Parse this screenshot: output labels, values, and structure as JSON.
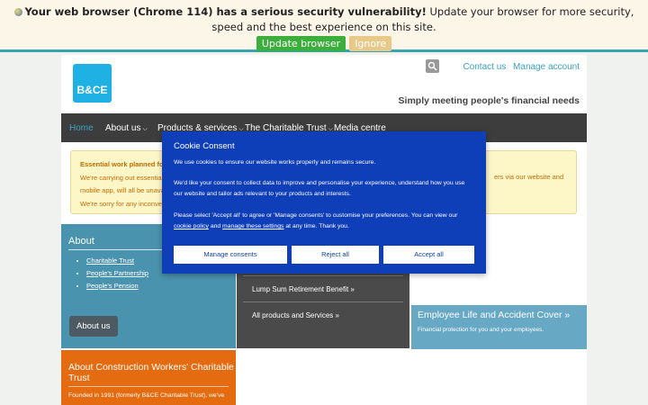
{
  "update_bar": {
    "bold_text": "Your web browser (Chrome 114) has a serious security vulnerability!",
    "rest_text": "Update your browser for more security, speed and the best experience on this site.",
    "update_label": "Update browser",
    "ignore_label": "Ignore"
  },
  "header": {
    "logo_text": "B&CE",
    "contact_label": "Contact us",
    "manage_label": "Manage account",
    "tagline": "Simply meeting people's financial needs"
  },
  "nav": {
    "items": [
      {
        "label": "Home"
      },
      {
        "label": "About us"
      },
      {
        "label": "Products & services"
      },
      {
        "label": "The Charitable Trust"
      },
      {
        "label": "Media centre"
      }
    ]
  },
  "notice": {
    "title": "Essential work planned for ou",
    "line1": "We're carrying out essential w",
    "line2": "mobile app, will all be unavai",
    "line3": "We're sorry for any inconveni",
    "right_text": "ers via our website and"
  },
  "about_tile": {
    "title": "About",
    "links": [
      "Charitable Trust",
      "People's Partnership",
      "People's Pension"
    ],
    "button_label": "About us"
  },
  "products_tile": {
    "links": [
      "Lump Sum Retirement Benefit »",
      "All products and Services »"
    ]
  },
  "employee_tile": {
    "title": "Employee Life and Accident Cover »",
    "desc": "Financial protection for you and your employees."
  },
  "cwt_tile": {
    "title": "About Construction Workers' Charitable Trust",
    "desc": "Founded in 1991 (formerly B&CE Charitable Trust), we've"
  },
  "cookie": {
    "title": "Cookie Consent",
    "p1": "We use cookies to ensure our website works properly and remains secure.",
    "p2": "We'd like your consent to collect data to improve and personalise your experience, understand how you use our website and tailor ads relevant to your products and interests.",
    "p3_a": "Please select 'Accept all' to agree or 'Manage consents' to customise your preferences. You can view our",
    "cookie_policy_link": "cookie policy",
    "p3_b": "and",
    "manage_settings_link": "manage these settings",
    "p3_c": "at any time. Thank you.",
    "manage_label": "Manage consents",
    "reject_label": "Reject all",
    "accept_label": "Accept all"
  }
}
